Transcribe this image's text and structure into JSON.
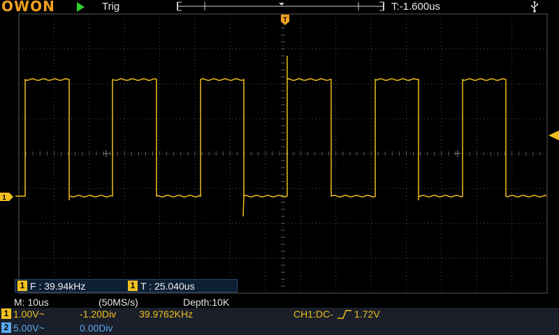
{
  "topbar": {
    "logo": "OWON",
    "run_state_icon": "play-icon",
    "trigger_label": "Trig",
    "time_offset": "T:-1.600us",
    "usb_icon": "usb-icon"
  },
  "measurements": {
    "freq": {
      "channel": "1",
      "text": "F : 39.94kHz"
    },
    "period": {
      "channel": "1",
      "text": "T : 25.040us"
    }
  },
  "status": {
    "timebase": "M: 10us",
    "sample_rate": "(50MS/s)",
    "depth": "Depth:10K"
  },
  "channels": [
    {
      "num": "1",
      "volts": "1.00V~",
      "offset": "-1.20Div",
      "freq": "39.9762KHz",
      "color": "#f0c020"
    },
    {
      "num": "2",
      "volts": "5.00V~",
      "offset": "0.00Div",
      "color": "#5aa8f0"
    }
  ],
  "trigger": {
    "source_coupling": "CH1:DC-",
    "level": "1.72V",
    "edge_icon": "rising-edge-icon"
  },
  "markers": {
    "ch1_marker": "1",
    "trigger_time_marker": "T"
  },
  "colors": {
    "ch1": "#f0c020",
    "ch2": "#5aa8f0",
    "grid": "#5a5a5a",
    "logo": "#f0a020",
    "run": "#2fd02f"
  }
}
